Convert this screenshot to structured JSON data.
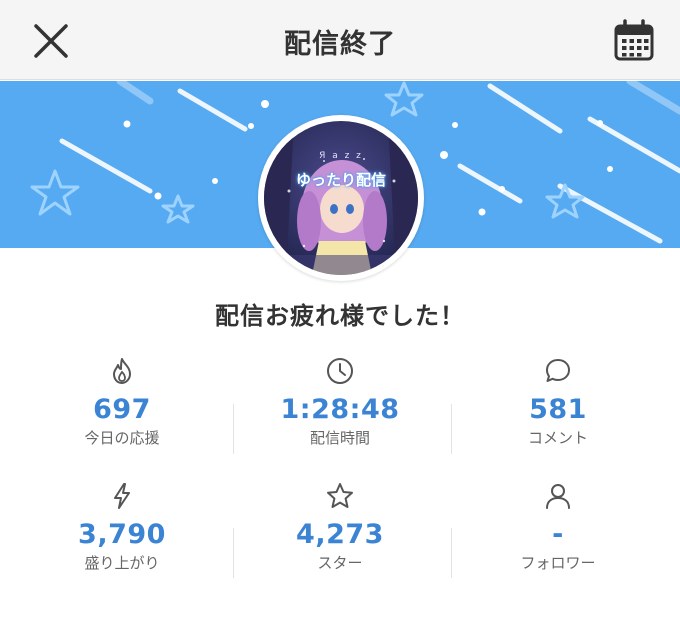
{
  "header": {
    "title": "配信終了",
    "close_icon": "close-icon",
    "calendar_icon": "calendar-icon"
  },
  "banner": {
    "color": "#56aaf2"
  },
  "avatar": {
    "brand": "Я a z z",
    "caption": "ゆったり配信"
  },
  "message": "配信お疲れ様でした！",
  "stats": [
    {
      "icon": "fire-icon",
      "value": "697",
      "label": "今日の応援"
    },
    {
      "icon": "clock-icon",
      "value": "1:28:48",
      "label": "配信時間"
    },
    {
      "icon": "comment-icon",
      "value": "581",
      "label": "コメント"
    },
    {
      "icon": "lightning-icon",
      "value": "3,790",
      "label": "盛り上がり"
    },
    {
      "icon": "star-icon",
      "value": "4,273",
      "label": "スター"
    },
    {
      "icon": "user-icon",
      "value": "-",
      "label": "フォロワー"
    }
  ],
  "colors": {
    "accent": "#3b84d4",
    "text": "#333333",
    "label": "#666666"
  }
}
